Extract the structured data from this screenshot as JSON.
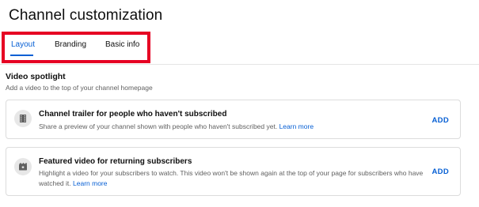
{
  "page": {
    "title": "Channel customization"
  },
  "tabs": [
    {
      "label": "Layout",
      "active": true
    },
    {
      "label": "Branding",
      "active": false
    },
    {
      "label": "Basic info",
      "active": false
    }
  ],
  "video_spotlight": {
    "title": "Video spotlight",
    "subtitle": "Add a video to the top of your channel homepage",
    "cards": [
      {
        "icon": "film-strip-icon",
        "title": "Channel trailer for people who haven't subscribed",
        "description": "Share a preview of your channel shown with people who haven't subscribed yet.",
        "learn_more": "Learn more",
        "action": "ADD"
      },
      {
        "icon": "featured-video-icon",
        "title": "Featured video for returning subscribers",
        "description": "Highlight a video for your subscribers to watch. This video won't be shown again at the top of your page for subscribers who have watched it.",
        "learn_more": "Learn more",
        "action": "ADD"
      }
    ]
  },
  "colors": {
    "accent": "#065fd4",
    "highlight": "#e60023",
    "text_secondary": "#606060"
  }
}
